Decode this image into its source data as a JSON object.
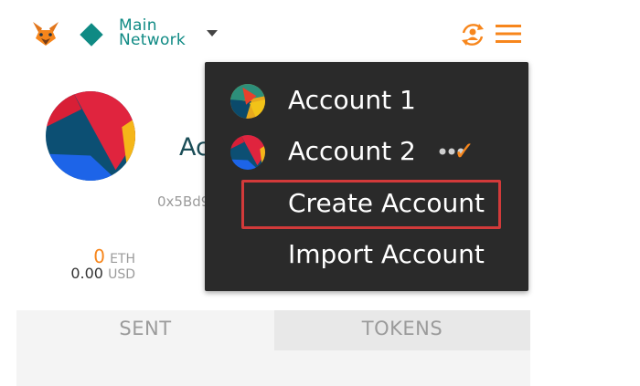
{
  "header": {
    "network_line1": "Main",
    "network_line2": "Network",
    "network_icon": "diamond-icon",
    "logo_icon": "fox-icon",
    "sync_icon": "sync-icon",
    "menu_icon": "hamburger-icon"
  },
  "account": {
    "name": "Account 2",
    "address": "0x5Bd9",
    "eth_amount": "0",
    "eth_unit": "ETH",
    "usd_amount": "0.00",
    "usd_unit": "USD"
  },
  "tabs": [
    {
      "label": "SENT",
      "active": true
    },
    {
      "label": "TOKENS",
      "active": false
    }
  ],
  "menu": {
    "items": [
      {
        "label": "Account 1"
      },
      {
        "label": "Account 2",
        "selected": true,
        "check": "✓"
      },
      {
        "label": "Create Account",
        "highlighted": true
      },
      {
        "label": "Import Account"
      }
    ]
  },
  "colors": {
    "accent": "#f7861c",
    "network": "#0f8a84",
    "menu_bg": "#2a2a2a",
    "highlight": "#d23a3a"
  }
}
